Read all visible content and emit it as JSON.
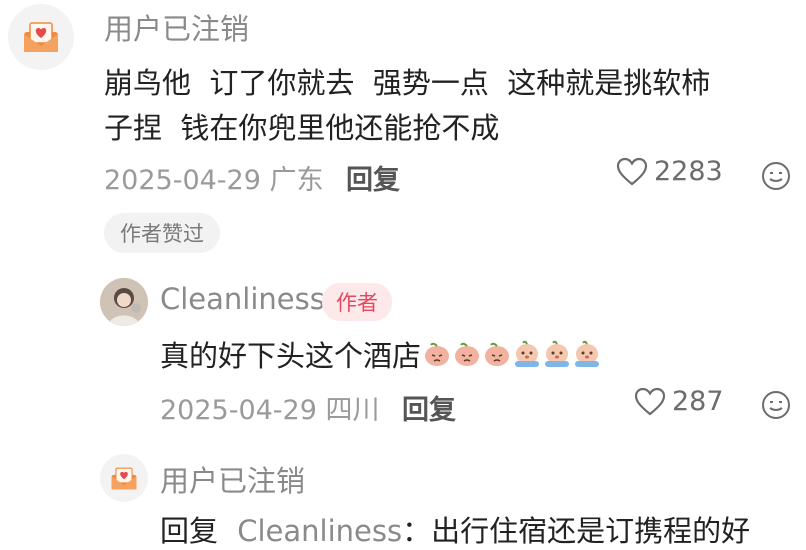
{
  "comment1": {
    "username": "用户已注销",
    "text_line1": "崩鸟他  订了你就去  强势一点  这种就是挑软柿",
    "text_line2": "子捏  钱在你兜里他还能抢不成",
    "date_location": "2025-04-29 广东",
    "reply_label": "回复",
    "like_count": "2283",
    "author_liked_tag": "作者赞过"
  },
  "reply1": {
    "username": "Cleanliness",
    "author_badge": "作者",
    "text": "真的好下头这个酒店",
    "emojis": [
      "sad-peach-emoji",
      "sad-peach-emoji",
      "sad-peach-emoji",
      "crying-emoji",
      "crying-emoji",
      "crying-emoji"
    ],
    "date_location": "2025-04-29 四川",
    "reply_label": "回复",
    "like_count": "287"
  },
  "reply2": {
    "username": "用户已注销",
    "reply_prefix": "回复",
    "mention": "Cleanliness",
    "text": "：出行住宿还是订携程的好"
  },
  "colors": {
    "accent": "#e4485e",
    "meta": "#9a9a9a",
    "mail_icon": "#f08a3e"
  }
}
